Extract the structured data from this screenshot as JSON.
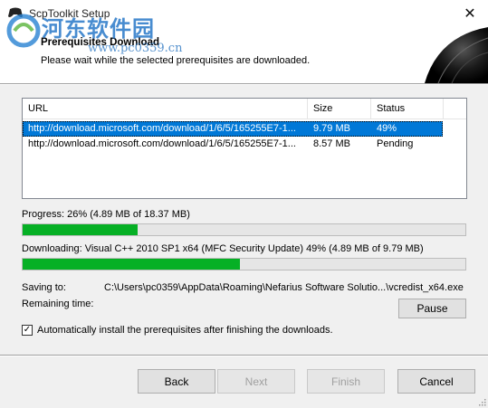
{
  "window": {
    "title": "ScpToolkit Setup",
    "close_glyph": "✕"
  },
  "header": {
    "title": "Prerequisites Download",
    "subtitle": "Please wait while the selected prerequisites are downloaded."
  },
  "watermark": {
    "text": "河东软件园",
    "url": "www.pc0359.cn"
  },
  "list": {
    "columns": [
      "URL",
      "Size",
      "Status"
    ],
    "rows": [
      {
        "url": "http://download.microsoft.com/download/1/6/5/165255E7-1...",
        "size": "9.79 MB",
        "status": "49%",
        "selected": true
      },
      {
        "url": "http://download.microsoft.com/download/1/6/5/165255E7-1...",
        "size": "8.57 MB",
        "status": "Pending",
        "selected": false
      }
    ]
  },
  "progress": {
    "label": "Progress: 26% (4.89 MB of 18.37 MB)",
    "fraction": 0.26
  },
  "downloading": {
    "label": "Downloading: Visual C++ 2010 SP1 x64 (MFC Security Update) 49%  (4.89 MB of 9.79 MB)",
    "fraction": 0.49
  },
  "saving": {
    "label": "Saving to:",
    "path": "C:\\Users\\pc0359\\AppData\\Roaming\\Nefarius Software Solutio...\\vcredist_x64.exe"
  },
  "remaining": {
    "label": "Remaining time:",
    "value": ""
  },
  "pause_button": "Pause",
  "auto_install": {
    "label": "Automatically install the prerequisites after finishing the downloads.",
    "checked": true,
    "check_glyph": "✓"
  },
  "buttons": {
    "back": "Back",
    "next": "Next",
    "finish": "Finish",
    "cancel": "Cancel"
  },
  "colors": {
    "progress_fill": "#06b025",
    "selection": "#0078d7"
  }
}
